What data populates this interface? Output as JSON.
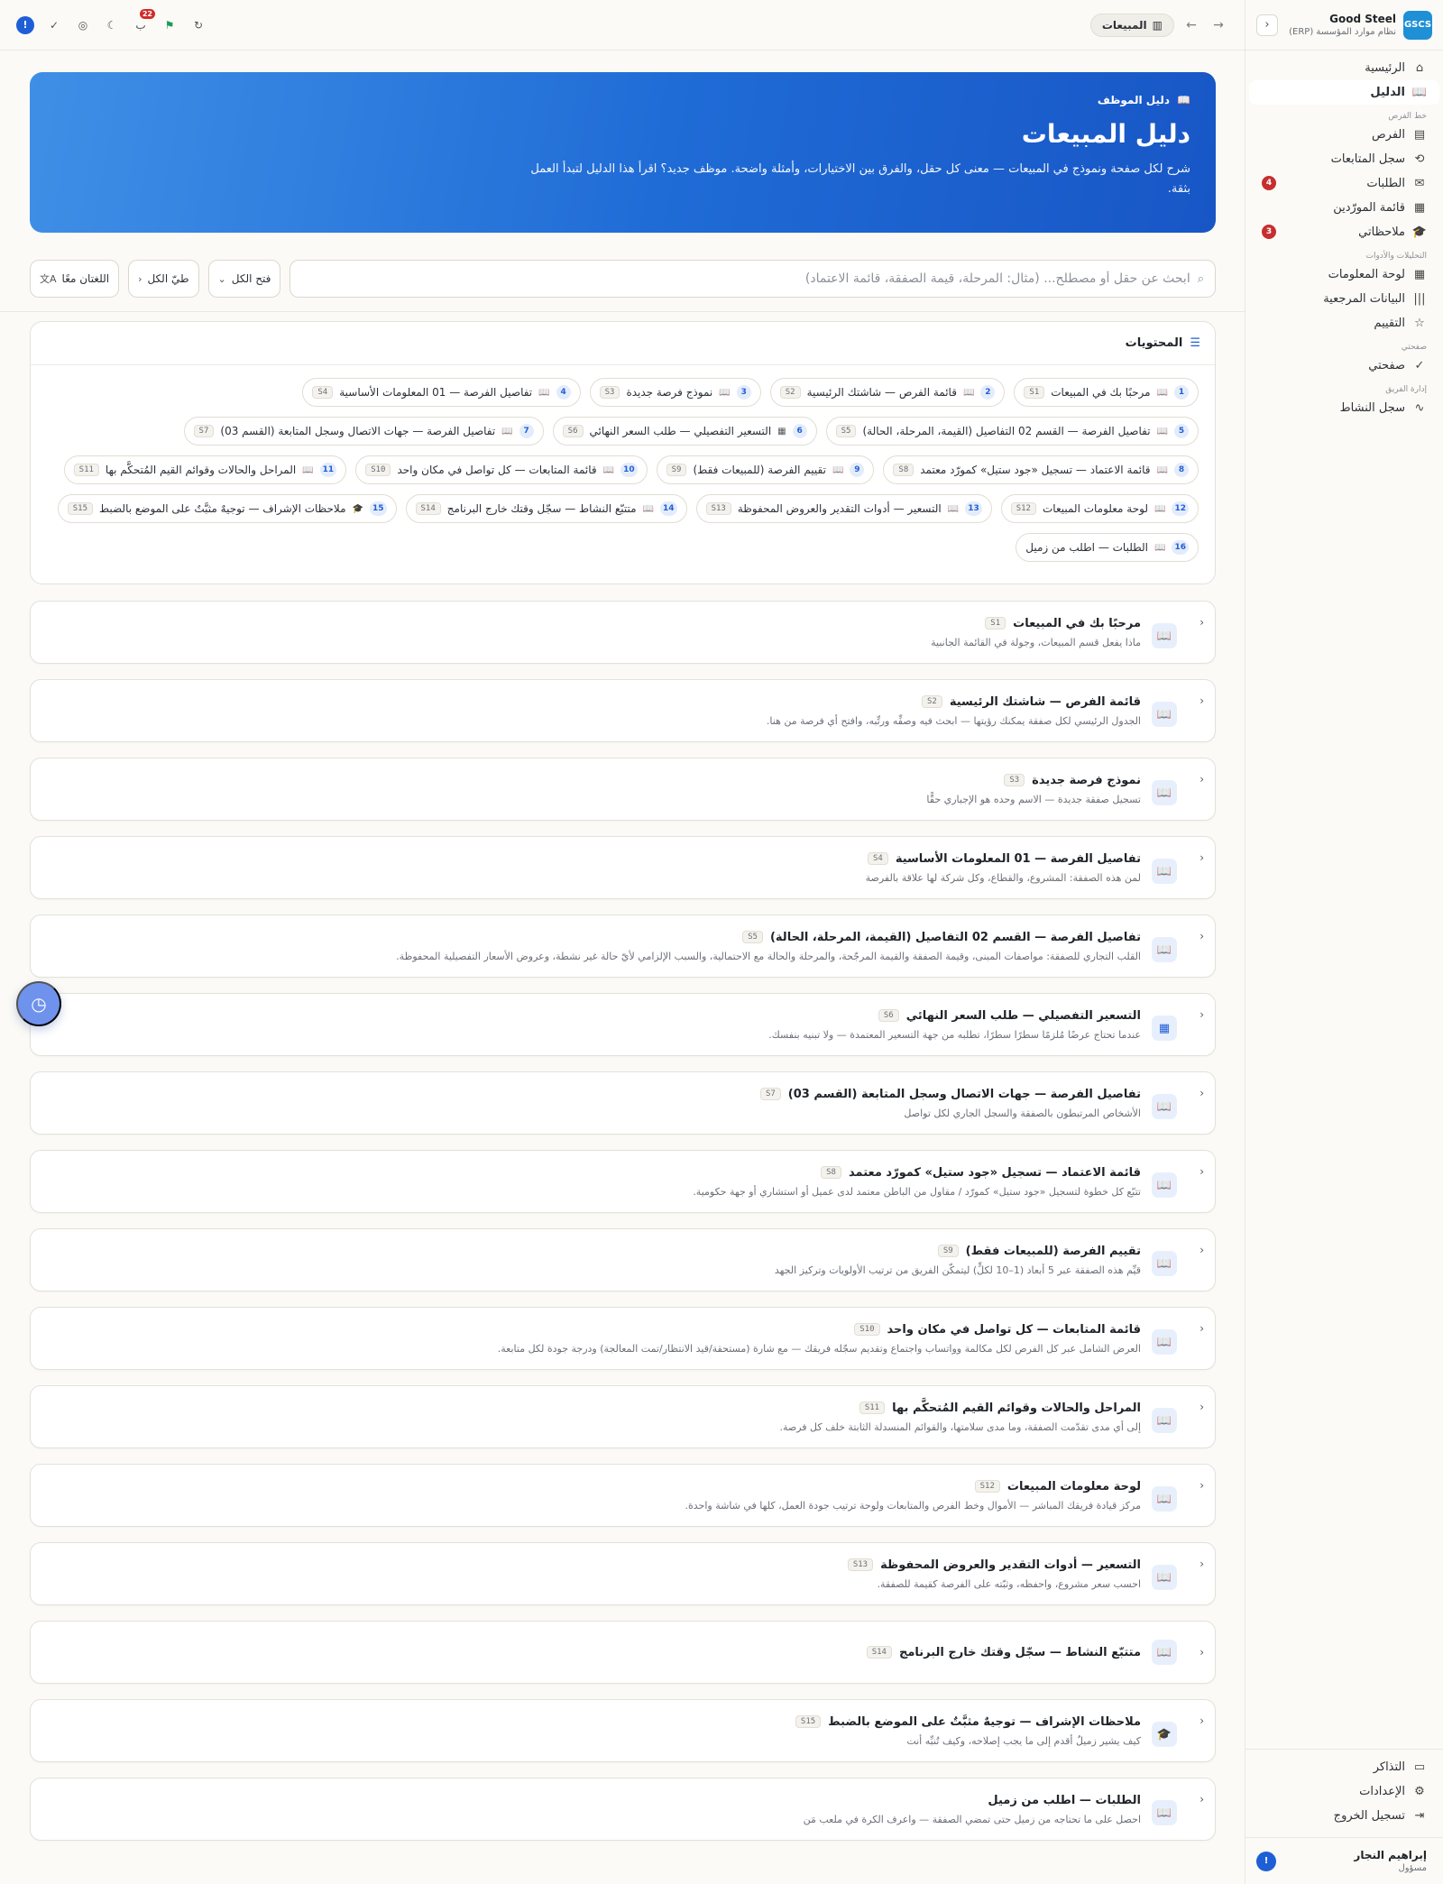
{
  "sidebar": {
    "brand_logo": "GSCS",
    "brand_name": "Good Steel",
    "brand_sub": "نظام موارد المؤسسة (ERP)",
    "collapse_icon": "chevron-left-icon",
    "items_top": [
      {
        "label": "الرئيسية",
        "icon": "home-icon",
        "glyph": "⌂"
      },
      {
        "label": "الدليل",
        "icon": "book-icon",
        "glyph": "📖",
        "active": true
      }
    ],
    "section_pipeline": "خط الفرص",
    "items_pipeline": [
      {
        "label": "الفرص",
        "icon": "briefcase-icon",
        "glyph": "▤"
      },
      {
        "label": "سجل المتابعات",
        "icon": "history-icon",
        "glyph": "⟲"
      },
      {
        "label": "الطلبات",
        "icon": "chat-icon",
        "glyph": "✉",
        "badge": "4"
      },
      {
        "label": "قائمة المورّدين",
        "icon": "clipboard-icon",
        "glyph": "▦"
      },
      {
        "label": "ملاحظاتي",
        "icon": "graduation-icon",
        "glyph": "🎓",
        "badge": "3"
      }
    ],
    "section_analytics": "التحليلات والأدوات",
    "items_analytics": [
      {
        "label": "لوحة المعلومات",
        "icon": "grid-icon",
        "glyph": "▦"
      },
      {
        "label": "البيانات المرجعية",
        "icon": "library-icon",
        "glyph": "|||"
      },
      {
        "label": "التقييم",
        "icon": "star-icon",
        "glyph": "☆"
      }
    ],
    "section_mypage": "صفحتي",
    "items_mypage": [
      {
        "label": "صفحتي",
        "icon": "check-circle-icon",
        "glyph": "✓"
      }
    ],
    "section_team": "إدارة الفريق",
    "items_team": [
      {
        "label": "سجل النشاط",
        "icon": "activity-icon",
        "glyph": "∿"
      }
    ],
    "items_bottom": [
      {
        "label": "التذاكر",
        "icon": "ticket-icon",
        "glyph": "▭"
      },
      {
        "label": "الإعدادات",
        "icon": "gear-icon",
        "glyph": "⚙"
      },
      {
        "label": "تسجيل الخروج",
        "icon": "logout-icon",
        "glyph": "⇥"
      }
    ],
    "user_name": "إبراهيم النجار",
    "user_role": "مسؤول",
    "user_avatar": "!"
  },
  "topbar": {
    "breadcrumb_label": "المبيعات",
    "breadcrumb_icon": "building-icon",
    "back_icon": "arrow-right-icon",
    "forward_icon": "arrow-left-icon",
    "notif_count": "22",
    "tools": [
      {
        "name": "help-icon",
        "glyph": "!"
      },
      {
        "name": "check-circle-icon",
        "glyph": "✓"
      },
      {
        "name": "globe-icon",
        "glyph": "◎"
      },
      {
        "name": "moon-icon",
        "glyph": "☾"
      },
      {
        "name": "notification-icon",
        "glyph": "ب"
      },
      {
        "name": "user-check-icon",
        "glyph": "⚑"
      },
      {
        "name": "refresh-icon",
        "glyph": "↻"
      }
    ]
  },
  "hero": {
    "tag": "دليل الموظف",
    "title": "دليل المبيعات",
    "description": "شرح لكل صفحة ونموذج في المبيعات — معنى كل حقل، والفرق بين الاختيارات، وأمثلة واضحة. موظف جديد؟ اقرأ هذا الدليل لتبدأ العمل بثقة."
  },
  "toolbar": {
    "search_placeholder": "ابحث عن حقل أو مصطلح... (مثال: المرحلة، قيمة الصفقة، قائمة الاعتماد)",
    "expand_all": "فتح الكل",
    "collapse_all": "طيّ الكل",
    "languages": "اللغتان معًا"
  },
  "toc": {
    "title": "المحتويات",
    "items": [
      {
        "num": "1",
        "label": "مرحبًا بك في المبيعات",
        "code": "S1",
        "icon": "book-icon"
      },
      {
        "num": "2",
        "label": "قائمة الفرص — شاشتك الرئيسية",
        "code": "S2",
        "icon": "book-icon"
      },
      {
        "num": "3",
        "label": "نموذج فرصة جديدة",
        "code": "S3",
        "icon": "book-icon"
      },
      {
        "num": "4",
        "label": "تفاصيل الفرصة — 01 المعلومات الأساسية",
        "code": "S4",
        "icon": "book-icon"
      },
      {
        "num": "5",
        "label": "تفاصيل الفرصة — القسم 02 التفاصيل (القيمة، المرحلة، الحالة)",
        "code": "S5",
        "icon": "book-icon"
      },
      {
        "num": "6",
        "label": "التسعير التفصيلي — طلب السعر النهائي",
        "code": "S6",
        "icon": "calculator-icon"
      },
      {
        "num": "7",
        "label": "تفاصيل الفرصة — جهات الاتصال وسجل المتابعة (القسم 03)",
        "code": "S7",
        "icon": "book-icon"
      },
      {
        "num": "8",
        "label": "قائمة الاعتماد — تسجيل «جود ستيل» كمورّد معتمد",
        "code": "S8",
        "icon": "book-icon"
      },
      {
        "num": "9",
        "label": "تقييم الفرصة (للمبيعات فقط)",
        "code": "S9",
        "icon": "book-icon"
      },
      {
        "num": "10",
        "label": "قائمة المتابعات — كل تواصل في مكان واحد",
        "code": "S10",
        "icon": "book-icon"
      },
      {
        "num": "11",
        "label": "المراحل والحالات وقوائم القيم المُتحكَّم بها",
        "code": "S11",
        "icon": "book-icon"
      },
      {
        "num": "12",
        "label": "لوحة معلومات المبيعات",
        "code": "S12",
        "icon": "book-icon"
      },
      {
        "num": "13",
        "label": "التسعير — أدوات التقدير والعروض المحفوظة",
        "code": "S13",
        "icon": "book-icon"
      },
      {
        "num": "14",
        "label": "متتبّع النشاط — سجّل وقتك خارج البرنامج",
        "code": "S14",
        "icon": "book-icon"
      },
      {
        "num": "15",
        "label": "ملاحظات الإشراف — توجيهٌ مثبَّتٌ على الموضع بالضبط",
        "code": "S15",
        "icon": "graduation-icon"
      },
      {
        "num": "16",
        "label": "الطلبات — اطلب من زميل",
        "code": "",
        "icon": "book-icon"
      }
    ]
  },
  "sections": [
    {
      "title": "مرحبًا بك في المبيعات",
      "code": "S1",
      "desc": "ماذا يفعل قسم المبيعات، وجولة في القائمة الجانبية",
      "icon": "book-icon",
      "glyph": "📖"
    },
    {
      "title": "قائمة الفرص — شاشتك الرئيسية",
      "code": "S2",
      "desc": "الجدول الرئيسي لكل صفقة يمكنك رؤيتها — ابحث فيه وصفِّه ورتِّبه، وافتح أي فرصة من هنا.",
      "icon": "book-icon",
      "glyph": "📖"
    },
    {
      "title": "نموذج فرصة جديدة",
      "code": "S3",
      "desc": "تسجيل صفقة جديدة — الاسم وحده هو الإجباري حقًّا",
      "icon": "book-icon",
      "glyph": "📖"
    },
    {
      "title": "تفاصيل الفرصة — 01 المعلومات الأساسية",
      "code": "S4",
      "desc": "لمن هذه الصفقة: المشروع، والقطاع، وكل شركة لها علاقة بالفرصة",
      "icon": "book-icon",
      "glyph": "📖"
    },
    {
      "title": "تفاصيل الفرصة — القسم 02 التفاصيل (القيمة، المرحلة، الحالة)",
      "code": "S5",
      "desc": "القلب التجاري للصفقة: مواصفات المبنى، وقيمة الصفقة والقيمة المرجّحة، والمرحلة والحالة مع الاحتمالية، والسبب الإلزامي لأيّ حالة غير نشطة، وعروض الأسعار التفصيلية المحفوظة.",
      "icon": "book-icon",
      "glyph": "📖"
    },
    {
      "title": "التسعير التفصيلي — طلب السعر النهائي",
      "code": "S6",
      "desc": "عندما تحتاج عرضًا مُلزمًا سطرًا سطرًا، تطلبه من جهة التسعير المعتمدة — ولا تبنيه بنفسك.",
      "icon": "calculator-icon",
      "glyph": "▦"
    },
    {
      "title": "تفاصيل الفرصة — جهات الاتصال وسجل المتابعة (القسم 03)",
      "code": "S7",
      "desc": "الأشخاص المرتبطون بالصفقة والسجل الجاري لكل تواصل",
      "icon": "book-icon",
      "glyph": "📖"
    },
    {
      "title": "قائمة الاعتماد — تسجيل «جود ستيل» كمورّد معتمد",
      "code": "S8",
      "desc": "تتبّع كل خطوة لتسجيل «جود ستيل» كمورّد / مقاول من الباطن معتمد لدى عميل أو استشاري أو جهة حكومية.",
      "icon": "book-icon",
      "glyph": "📖"
    },
    {
      "title": "تقييم الفرصة (للمبيعات فقط)",
      "code": "S9",
      "desc": "قيِّم هذه الصفقة عبر 5 أبعاد (1–10 لكلٍّ) ليتمكّن الفريق من ترتيب الأولويات وتركيز الجهد",
      "icon": "book-icon",
      "glyph": "📖"
    },
    {
      "title": "قائمة المتابعات — كل تواصل في مكان واحد",
      "code": "S10",
      "desc": "العرض الشامل عبر كل الفرص لكل مكالمة وواتساب واجتماع وتقديم سجّله فريقك — مع شارة (مستحقة/قيد الانتظار/تمت المعالجة) ودرجة جودة لكل متابعة.",
      "icon": "book-icon",
      "glyph": "📖"
    },
    {
      "title": "المراحل والحالات وقوائم القيم المُتحكَّم بها",
      "code": "S11",
      "desc": "إلى أي مدى تقدّمت الصفقة، وما مدى سلامتها، والقوائم المنسدلة الثابتة خلف كل فرصة.",
      "icon": "book-icon",
      "glyph": "📖"
    },
    {
      "title": "لوحة معلومات المبيعات",
      "code": "S12",
      "desc": "مركز قيادة فريقك المباشر — الأموال وخط الفرص والمتابعات ولوحة ترتيب جودة العمل، كلها في شاشة واحدة.",
      "icon": "book-icon",
      "glyph": "📖"
    },
    {
      "title": "التسعير — أدوات التقدير والعروض المحفوظة",
      "code": "S13",
      "desc": "احسب سعر مشروع، واحفظه، وثبّته على الفرصة كقيمة للصفقة.",
      "icon": "book-icon",
      "glyph": "📖"
    },
    {
      "title": "متتبّع النشاط — سجّل وقتك خارج البرنامج",
      "code": "S14",
      "desc": "",
      "icon": "book-icon",
      "glyph": "📖"
    },
    {
      "title": "ملاحظات الإشراف — توجيهٌ مثبَّتٌ على الموضع بالضبط",
      "code": "S15",
      "desc": "كيف يشير زميلٌ أقدم إلى ما يجب إصلاحه، وكيف تُنبِّه أنت",
      "icon": "graduation-icon",
      "glyph": "🎓"
    },
    {
      "title": "الطلبات — اطلب من زميل",
      "code": "",
      "desc": "احصل على ما تحتاجه من زميل حتى تمضي الصفقة — واعرف الكرة في ملعب مَن",
      "icon": "book-icon",
      "glyph": "📖"
    }
  ],
  "fab_icon": "clock-icon",
  "colors": {
    "accent": "#1f5fd6",
    "hero_from": "#3f8fe6",
    "hero_to": "#1856c6",
    "badge_red": "#c62f2f",
    "brand_logo_bg": "#1f8fd6"
  }
}
